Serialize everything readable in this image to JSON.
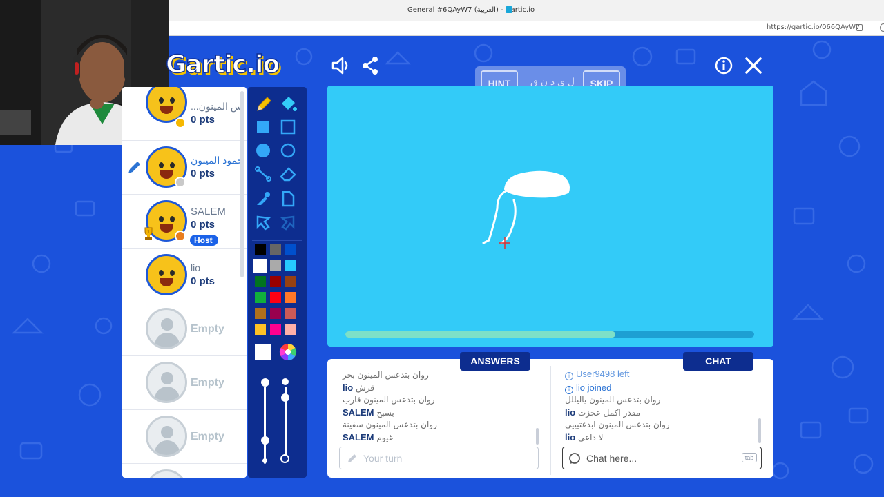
{
  "browser": {
    "window_title": "General #6QAyW7 (العربية) - Gartic.io",
    "url": "https://gartic.io/066QAyW7"
  },
  "logo": {
    "text": "Gartic.io"
  },
  "hint": {
    "hint_label": "HINT",
    "skip_label": "SKIP",
    "word": "ل ي د ن ق"
  },
  "players": [
    {
      "name": "...س المينون",
      "points": "0 pts",
      "status_color": "#f6b800"
    },
    {
      "name": "حمود المينون",
      "points": "0 pts",
      "status_color": "#c9c9c9",
      "drawing": true
    },
    {
      "name": "SALEM",
      "points": "0 pts",
      "status_color": "#e87d1e",
      "host_label": "Host",
      "trophy_rank": "1"
    },
    {
      "name": "lio",
      "points": "0 pts"
    }
  ],
  "empty_slots": [
    {
      "label": "Empty"
    },
    {
      "label": "Empty"
    },
    {
      "label": "Empty"
    }
  ],
  "palette": {
    "colors": [
      [
        "#000000",
        "#666666",
        "#0050cd"
      ],
      [
        "#ffffff",
        "#aaaaaa",
        "#26c9ff"
      ],
      [
        "#017420",
        "#990000",
        "#964112"
      ],
      [
        "#11b03c",
        "#ff0013",
        "#ff7829"
      ],
      [
        "#b0701c",
        "#99004e",
        "#cb5a57"
      ],
      [
        "#ffc126",
        "#ff008f",
        "#feafa8"
      ]
    ],
    "selected": "#ffffff"
  },
  "canvas": {
    "background": "#33cbf8",
    "timer_fraction": 0.66
  },
  "answers": {
    "tab_label": "ANSWERS",
    "messages": [
      {
        "user": "",
        "text": "روان بتدعس المينون بحر"
      },
      {
        "user": "lio",
        "text": "قرش"
      },
      {
        "user": "",
        "text": "روان بتدعس المينون قارب"
      },
      {
        "user": "SALEM",
        "text": "بسبح"
      },
      {
        "user": "",
        "text": "روان بتدعس المينون سفينة"
      },
      {
        "user": "SALEM",
        "text": "غيوم"
      }
    ],
    "input_placeholder": "Your turn"
  },
  "chat": {
    "tab_label": "CHAT",
    "system_messages": [
      {
        "text": "User9498 left"
      },
      {
        "text": "lio joined"
      }
    ],
    "messages": [
      {
        "user": "",
        "text": "روان بتدعس المينون ياليللل"
      },
      {
        "user": "lio",
        "text": "مقدر اكمل عجزت"
      },
      {
        "user": "",
        "text": "روان بتدعس المينون ابدعتيييي"
      },
      {
        "user": "lio",
        "text": "لا داعي"
      }
    ],
    "input_placeholder": "Chat here...",
    "tab_hint": "tab"
  }
}
